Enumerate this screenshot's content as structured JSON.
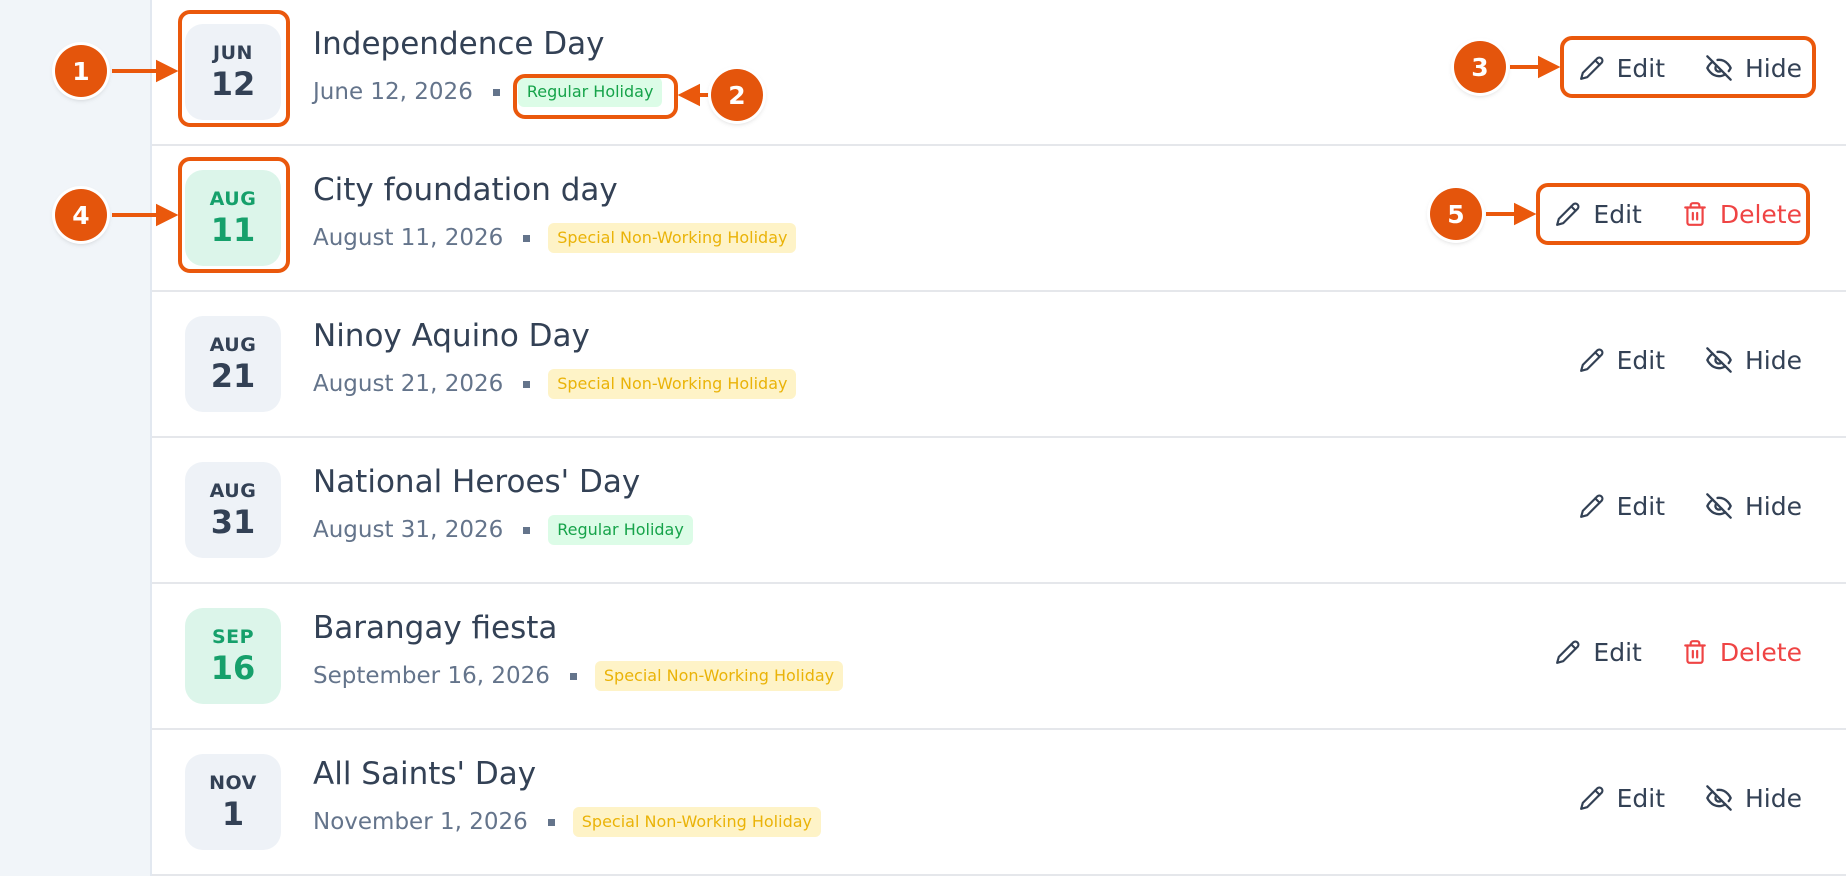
{
  "colors": {
    "annotation": "#ea580c",
    "regular_badge_bg": "#dcfce7",
    "regular_badge_text": "#16a34a",
    "special_badge_bg": "#fef3c7",
    "special_badge_text": "#eab308",
    "delete": "#ef4444",
    "custom_date_bg": "#dcf5ea",
    "custom_date_text": "#16a06b"
  },
  "holidays": [
    {
      "month": "JUN",
      "day": "12",
      "name": "Independence Day",
      "date": "June 12, 2026",
      "type": "Regular Holiday",
      "custom": false,
      "secondary_action": "Hide",
      "secondary_icon": "eye-off-icon"
    },
    {
      "month": "AUG",
      "day": "11",
      "name": "City foundation day",
      "date": "August 11, 2026",
      "type": "Special Non-Working Holiday",
      "custom": true,
      "secondary_action": "Delete",
      "secondary_icon": "trash-icon"
    },
    {
      "month": "AUG",
      "day": "21",
      "name": "Ninoy Aquino Day",
      "date": "August 21, 2026",
      "type": "Special Non-Working Holiday",
      "custom": false,
      "secondary_action": "Hide",
      "secondary_icon": "eye-off-icon"
    },
    {
      "month": "AUG",
      "day": "31",
      "name": "National Heroes' Day",
      "date": "August 31, 2026",
      "type": "Regular Holiday",
      "custom": false,
      "secondary_action": "Hide",
      "secondary_icon": "eye-off-icon"
    },
    {
      "month": "SEP",
      "day": "16",
      "name": "Barangay fiesta",
      "date": "September 16, 2026",
      "type": "Special Non-Working Holiday",
      "custom": true,
      "secondary_action": "Delete",
      "secondary_icon": "trash-icon"
    },
    {
      "month": "NOV",
      "day": "1",
      "name": "All Saints' Day",
      "date": "November 1, 2026",
      "type": "Special Non-Working Holiday",
      "custom": false,
      "secondary_action": "Hide",
      "secondary_icon": "eye-off-icon"
    }
  ],
  "edit_label": "Edit",
  "annotations": [
    "1",
    "2",
    "3",
    "4",
    "5"
  ]
}
